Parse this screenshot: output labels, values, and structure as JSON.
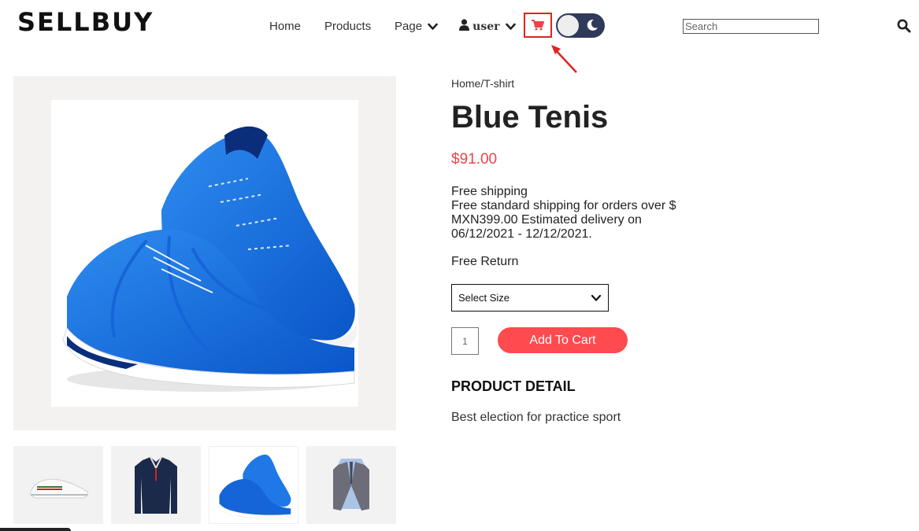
{
  "header": {
    "logo": "SELLBUY",
    "nav": {
      "home": "Home",
      "products": "Products",
      "page": "Page",
      "user": "user"
    },
    "search": {
      "placeholder": "Search"
    }
  },
  "gallery": {
    "main_image": "blue-running-shoes",
    "thumbnails": [
      "white-sneaker",
      "navy-polo-shirt",
      "blue-running-shoes",
      "grey-vest"
    ]
  },
  "product": {
    "breadcrumb": "Home/T-shirt",
    "title": "Blue Tenis",
    "price": "$91.00",
    "shipping_title": "Free shipping",
    "shipping_desc": "Free standard shipping for orders over $ MXN399.00 Estimated delivery on 06/12/2021 - 12/12/2021.",
    "free_return": "Free Return",
    "size_select": "Select Size",
    "quantity": "1",
    "add_to_cart": "Add To Cart",
    "detail_heading": "PRODUCT DETAIL",
    "detail_text": "Best election for practice sport"
  },
  "colors": {
    "accent": "#ff4a4f",
    "price": "#e8454a",
    "toggle": "#2f3a5a",
    "highlight": "#e32222"
  }
}
